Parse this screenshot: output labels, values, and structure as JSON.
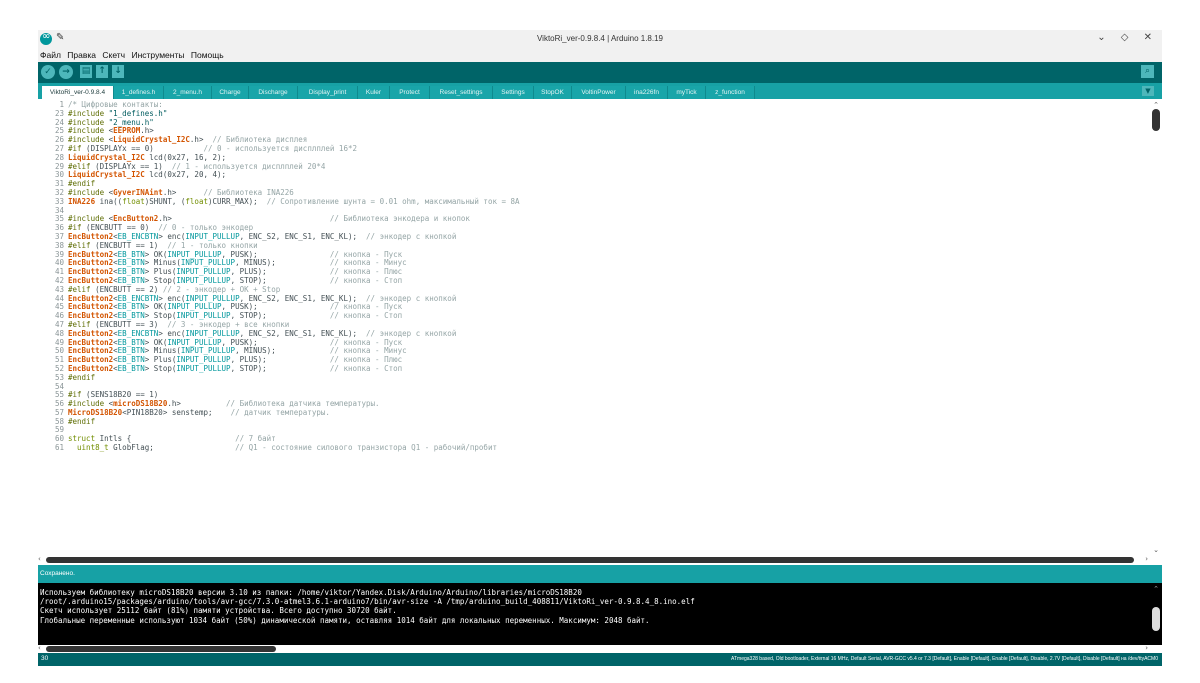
{
  "window": {
    "title": "ViktoRi_ver-0.9.8.4 | Arduino 1.8.19",
    "controls": "⌄ ◇ ✕"
  },
  "menu": [
    "Файл",
    "Правка",
    "Скетч",
    "Инструменты",
    "Помощь"
  ],
  "toolbar": {
    "buttons": [
      "verify-icon",
      "upload-icon",
      "new-icon",
      "open-icon",
      "save-icon"
    ],
    "serial_monitor_icon": "serial-monitor-icon"
  },
  "tabs": [
    "ViktoRi_ver-0.9.8.4",
    "1_defines.h",
    "2_menu.h",
    "Charge",
    "Discharge",
    "Display_print",
    "Kuler",
    "Protect",
    "Reset_settings",
    "Settings",
    "StopOK",
    "VoltinPower",
    "ina226fn",
    "myTick",
    "z_function"
  ],
  "editor": {
    "lines": [
      {
        "n": "1",
        "code": "/* Цифровые контакты:"
      },
      {
        "n": "23",
        "code": "#include \"1_defines.h\""
      },
      {
        "n": "24",
        "code": "#include \"2_menu.h\""
      },
      {
        "n": "25",
        "code": "#include <EEPROM.h>"
      },
      {
        "n": "26",
        "code": "#include <LiquidCrystal_I2C.h>  // Библиотека дисплея"
      },
      {
        "n": "27",
        "code": "#if (DISPLAYx == 0)           // 0 - используется дисплплей 16*2"
      },
      {
        "n": "28",
        "code": "LiquidCrystal_I2C lcd(0x27, 16, 2);"
      },
      {
        "n": "29",
        "code": "#elif (DISPLAYx == 1)  // 1 - используется дисплплей 20*4"
      },
      {
        "n": "30",
        "code": "LiquidCrystal_I2C lcd(0x27, 20, 4);"
      },
      {
        "n": "31",
        "code": "#endif"
      },
      {
        "n": "32",
        "code": "#include <GyverINAint.h>      // Библиотека INA226"
      },
      {
        "n": "33",
        "code": "INA226 ina((float)SHUNT, (float)CURR_MAX);  // Сопротивление шунта = 0.01 ohm, максимальный ток = 8A"
      },
      {
        "n": "34",
        "code": ""
      },
      {
        "n": "35",
        "code": "#include <EncButton2.h>                                   // Библиотека энкодера и кнопок"
      },
      {
        "n": "36",
        "code": "#if (ENCBUTT == 0)  // 0 - только энкодер"
      },
      {
        "n": "37",
        "code": "EncButton2<EB_ENCBTN> enc(INPUT_PULLUP, ENC_S2, ENC_S1, ENC_KL);  // энкодер с кнопкой"
      },
      {
        "n": "38",
        "code": "#elif (ENCBUTT == 1)  // 1 - только кнопки"
      },
      {
        "n": "39",
        "code": "EncButton2<EB_BTN> OK(INPUT_PULLUP, PUSK);                // кнопка - Пуск"
      },
      {
        "n": "40",
        "code": "EncButton2<EB_BTN> Minus(INPUT_PULLUP, MINUS);            // кнопка - Минус"
      },
      {
        "n": "41",
        "code": "EncButton2<EB_BTN> Plus(INPUT_PULLUP, PLUS);              // кнопка - Плюс"
      },
      {
        "n": "42",
        "code": "EncButton2<EB_BTN> Stop(INPUT_PULLUP, STOP);              // кнопка - Стоп"
      },
      {
        "n": "43",
        "code": "#elif (ENCBUTT == 2) // 2 - энкодер + OK + Stop"
      },
      {
        "n": "44",
        "code": "EncButton2<EB_ENCBTN> enc(INPUT_PULLUP, ENC_S2, ENC_S1, ENC_KL);  // энкодер с кнопкой"
      },
      {
        "n": "45",
        "code": "EncButton2<EB_BTN> OK(INPUT_PULLUP, PUSK);                // кнопка - Пуск"
      },
      {
        "n": "46",
        "code": "EncButton2<EB_BTN> Stop(INPUT_PULLUP, STOP);              // кнопка - Стоп"
      },
      {
        "n": "47",
        "code": "#elif (ENCBUTT == 3)  // 3 - энкодер + все кнопки"
      },
      {
        "n": "48",
        "code": "EncButton2<EB_ENCBTN> enc(INPUT_PULLUP, ENC_S2, ENC_S1, ENC_KL);  // энкодер с кнопкой"
      },
      {
        "n": "49",
        "code": "EncButton2<EB_BTN> OK(INPUT_PULLUP, PUSK);                // кнопка - Пуск"
      },
      {
        "n": "50",
        "code": "EncButton2<EB_BTN> Minus(INPUT_PULLUP, MINUS);            // кнопка - Минус"
      },
      {
        "n": "51",
        "code": "EncButton2<EB_BTN> Plus(INPUT_PULLUP, PLUS);              // кнопка - Плюс"
      },
      {
        "n": "52",
        "code": "EncButton2<EB_BTN> Stop(INPUT_PULLUP, STOP);              // кнопка - Стоп"
      },
      {
        "n": "53",
        "code": "#endif"
      },
      {
        "n": "54",
        "code": ""
      },
      {
        "n": "55",
        "code": "#if (SENS18B20 == 1)"
      },
      {
        "n": "56",
        "code": "#include <microDS18B20.h>          // Библиотека датчика температуры."
      },
      {
        "n": "57",
        "code": "MicroDS18B20<PIN18B20> senstemp;    // датчик температуры."
      },
      {
        "n": "58",
        "code": "#endif"
      },
      {
        "n": "59",
        "code": ""
      },
      {
        "n": "60",
        "code": "struct Intls {                       // 7 байт"
      },
      {
        "n": "61",
        "code": "  uint8_t GlobFlag;                  // Q1 - состояние силового транзистора Q1 - рабочий/пробит"
      }
    ]
  },
  "status": "Сохранено.",
  "console": [
    "Используем библиотеку microDS18B20 версии 3.10 из папки: /home/viktor/Yandex.Disk/Arduino/Arduino/libraries/microDS18B20",
    "/root/.arduino15/packages/arduino/tools/avr-gcc/7.3.0-atmel3.6.1-arduino7/bin/avr-size -A /tmp/arduino_build_408811/ViktoRi_ver-0.9.8.4_8.ino.elf",
    "Скетч использует 25112 байт (81%) памяти устройства. Всего доступно 30720 байт.",
    "Глобальные переменные используют 1034 байт (50%) динамической памяти, оставляя 1014 байт для локальных переменных. Максимум: 2048 байт."
  ],
  "footer": {
    "line": "30",
    "board": "ATmega328 based, Old bootloader, External 16 MHz, Default Serial, AVR-GCC v5.4 or 7.3 [Default], Enable [Default], Enable [Default], Disable, 2.7V [Default], Disable [Default] на /dev/ttyACM0"
  },
  "colors": {
    "toolbar": "#006468",
    "tabs": "#17a1a5",
    "console": "#000000"
  }
}
